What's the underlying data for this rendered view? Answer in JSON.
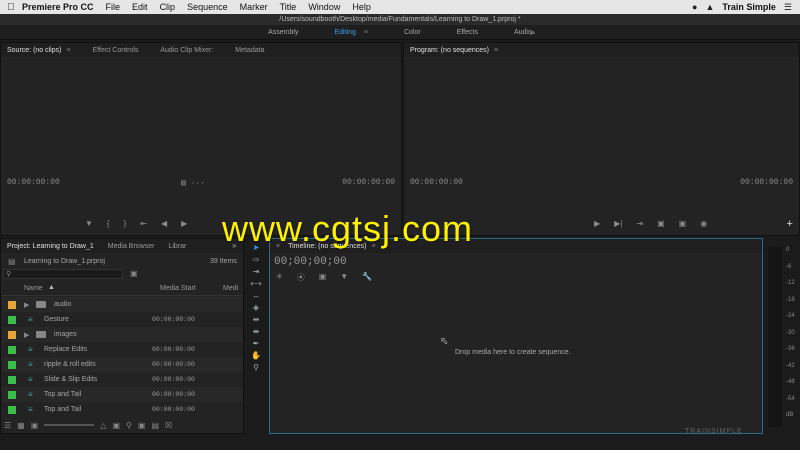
{
  "menubar": {
    "apple": "",
    "app": "Premiere Pro CC",
    "items": [
      "File",
      "Edit",
      "Clip",
      "Sequence",
      "Marker",
      "Title",
      "Window",
      "Help"
    ],
    "brand": "Train Simple"
  },
  "path": "/Users/soundbooth/Desktop/media/Fundamentals/Learning to Draw_1.prproj *",
  "workspaces": [
    "Assembly",
    "Editing",
    "Color",
    "Effects",
    "Audio"
  ],
  "active_workspace": "Editing",
  "source": {
    "tabs": [
      "Source: (no clips)",
      "Effect Controls",
      "Audio Clip Mixer:",
      "Metadata"
    ],
    "tc_left": "00:00:00:00",
    "tc_right": "00:00:00:00"
  },
  "program": {
    "tab": "Program: (no sequences)",
    "tc_left": "00:00:00:00",
    "tc_right": "00:00:00:00"
  },
  "project": {
    "tabs": [
      "Project: Learning to Draw_1",
      "Media Browser",
      "Librar"
    ],
    "filename": "Learning to Draw_1.prproj",
    "count": "39 Items",
    "col_name": "Name",
    "col_start": "Media Start",
    "col_more": "Medi",
    "rows": [
      {
        "type": "folder",
        "color": "#e8a33c",
        "name": "audio",
        "start": ""
      },
      {
        "type": "clip",
        "color": "#3cbf4a",
        "name": "Gesture",
        "start": "00:00:00:00"
      },
      {
        "type": "folder",
        "color": "#e8a33c",
        "name": "images",
        "start": ""
      },
      {
        "type": "clip",
        "color": "#3cbf4a",
        "name": "Replace Edits",
        "start": "00:00:00:00"
      },
      {
        "type": "clip",
        "color": "#3cbf4a",
        "name": "ripple & roll edits",
        "start": "00:00:00:00"
      },
      {
        "type": "clip",
        "color": "#3cbf4a",
        "name": "Slide & Slip Edits",
        "start": "00:00:00:00"
      },
      {
        "type": "clip",
        "color": "#3cbf4a",
        "name": "Top and Tail",
        "start": "00:00:00:00"
      },
      {
        "type": "clip",
        "color": "#3cbf4a",
        "name": "Top and Tail",
        "start": "00:00:00:00"
      }
    ]
  },
  "timeline": {
    "tab": "Timeline: (no sequences)",
    "tc": "00;00;00;00",
    "drop": "Drop media here to create sequence."
  },
  "meter_levels": [
    "0",
    "-6",
    "-12",
    "-18",
    "-24",
    "-30",
    "-36",
    "-42",
    "-48",
    "-54",
    "dB"
  ],
  "watermark": "www.cgtsj.com",
  "corner_brand": "TRAINSIMPLE"
}
